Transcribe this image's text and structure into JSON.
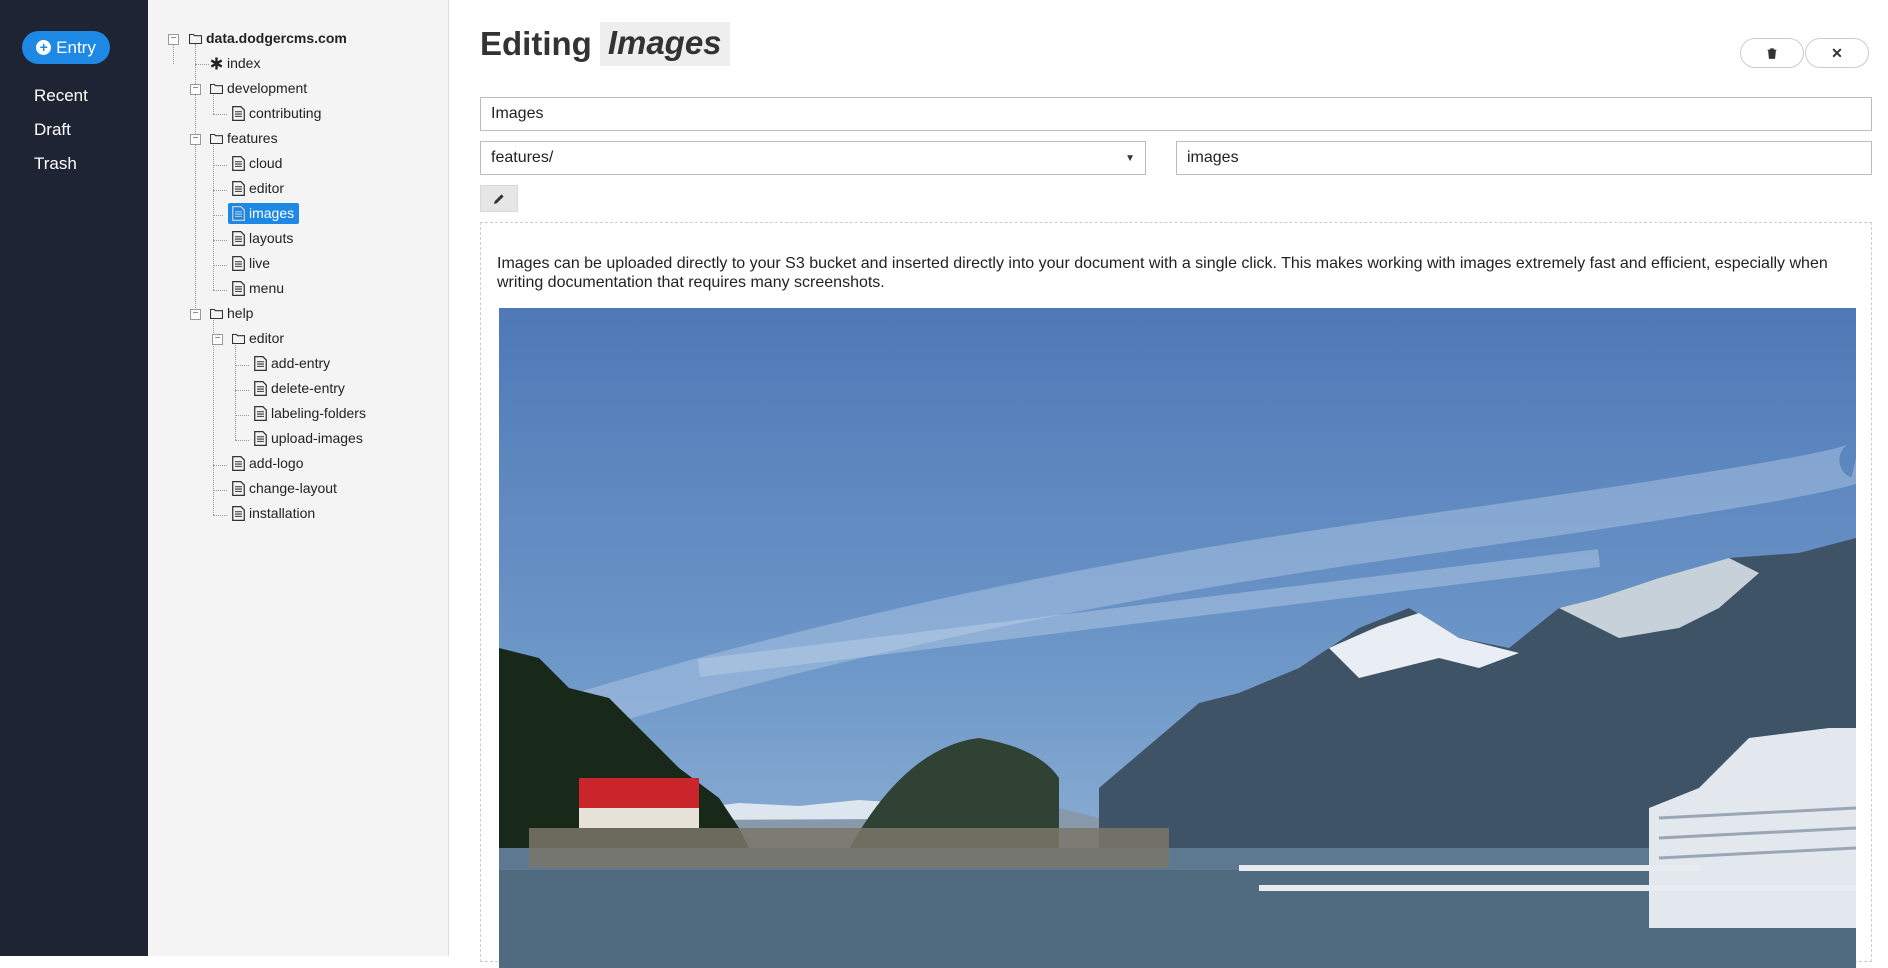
{
  "nav": {
    "entry_label": "Entry",
    "links": [
      "Recent",
      "Draft",
      "Trash"
    ]
  },
  "tree": {
    "root": "data.dodgercms.com",
    "nodes": [
      "index",
      "development",
      "contributing",
      "features",
      "cloud",
      "editor",
      "images",
      "layouts",
      "live",
      "menu",
      "help",
      "editor",
      "add-entry",
      "delete-entry",
      "labeling-folders",
      "upload-images",
      "add-logo",
      "change-layout",
      "installation"
    ],
    "selected": "images"
  },
  "editor": {
    "heading_prefix": "Editing",
    "heading_name": "Images",
    "title_value": "Images",
    "folder_value": "features/",
    "slug_value": "images",
    "body_text": "Images can be uploaded directly to your S3 bucket and inserted directly into your document with a single click. This makes working with images extremely fast and efficient, especially when writing documentation that requires many screenshots."
  },
  "icons": {
    "entry": "plus-circle-icon",
    "delete": "trash-icon",
    "close": "close-icon",
    "edit": "pencil-icon",
    "folder": "folder-icon",
    "file": "file-icon",
    "index": "asterisk-icon"
  },
  "colors": {
    "nav_bg": "#1f2434",
    "accent": "#1e88e5",
    "tree_bg": "#f4f4f4"
  }
}
